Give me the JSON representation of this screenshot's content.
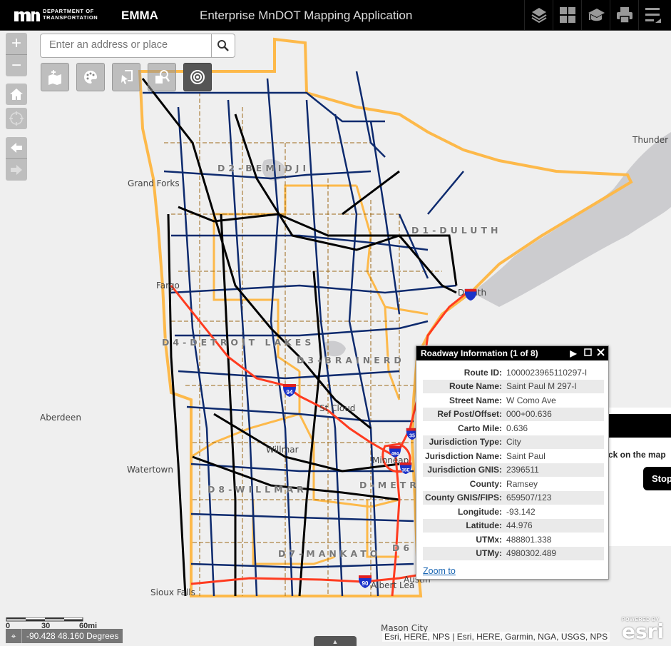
{
  "header": {
    "logo_text_line1": "DEPARTMENT OF",
    "logo_text_line2": "TRANSPORTATION",
    "app_name": "EMMA",
    "app_title": "Enterprise MnDOT Mapping Application",
    "buttons": [
      {
        "name": "layers",
        "icon": "layers-icon"
      },
      {
        "name": "basemap-gallery",
        "icon": "grid-icon"
      },
      {
        "name": "help",
        "icon": "graduation-cap-icon"
      },
      {
        "name": "print",
        "icon": "printer-icon"
      },
      {
        "name": "menu",
        "icon": "menu-icon"
      }
    ]
  },
  "map_controls": {
    "zoom_in": "+",
    "zoom_out": "−",
    "search_placeholder": "Enter an address or place",
    "search_value": "",
    "tools": [
      {
        "name": "add-data",
        "icon": "add-data-icon",
        "active": false
      },
      {
        "name": "symbology",
        "icon": "palette-icon",
        "active": false
      },
      {
        "name": "select",
        "icon": "select-icon",
        "active": false
      },
      {
        "name": "query",
        "icon": "query-icon",
        "active": false
      },
      {
        "name": "identify",
        "icon": "target-icon",
        "active": true
      }
    ]
  },
  "map_labels": {
    "places": [
      {
        "id": "grand-forks",
        "text": "Grand Forks"
      },
      {
        "id": "fargo",
        "text": "Fargo"
      },
      {
        "id": "duluth",
        "text": "Duluth"
      },
      {
        "id": "thunder-bay",
        "text": "Thunder B"
      },
      {
        "id": "aberdeen",
        "text": "Aberdeen"
      },
      {
        "id": "watertown",
        "text": "Watertown"
      },
      {
        "id": "st-cloud",
        "text": "St Cloud"
      },
      {
        "id": "willmar",
        "text": "Willmar"
      },
      {
        "id": "minneapolis",
        "text": "Minneap"
      },
      {
        "id": "sioux-falls",
        "text": "Sioux Falls"
      },
      {
        "id": "albert-lea",
        "text": "Albert Lea"
      },
      {
        "id": "austin",
        "text": "Austin"
      },
      {
        "id": "mason-city",
        "text": "Mason City"
      }
    ],
    "districts": [
      {
        "id": "d2",
        "text": "D2-BEMIDJI"
      },
      {
        "id": "d1",
        "text": "D1-DULUTH"
      },
      {
        "id": "d4",
        "text": "D4-DETROIT LAKES"
      },
      {
        "id": "d3",
        "text": "D3-BRAINERD"
      },
      {
        "id": "d8",
        "text": "D8-WILLMAR"
      },
      {
        "id": "metro",
        "text": "D-METRO"
      },
      {
        "id": "d7",
        "text": "D7-MANKATO"
      },
      {
        "id": "d6",
        "text": "D6"
      }
    ],
    "interstate_shields": [
      "94",
      "35",
      "494",
      "35E",
      "90"
    ]
  },
  "popup": {
    "title": "Roadway Information (1 of 8)",
    "fields": [
      {
        "label": "Route ID:",
        "value": "1000023965110297-I"
      },
      {
        "label": "Route Name:",
        "value": "Saint Paul M 297-I"
      },
      {
        "label": "Street Name:",
        "value": "W Como Ave"
      },
      {
        "label": "Ref Post/Offset:",
        "value": "000+00.636"
      },
      {
        "label": "Carto Mile:",
        "value": "0.636"
      },
      {
        "label": "Jurisdiction Type:",
        "value": "City"
      },
      {
        "label": "Jurisdiction Name:",
        "value": "Saint Paul"
      },
      {
        "label": "Jurisdiction GNIS:",
        "value": "2396511"
      },
      {
        "label": "County:",
        "value": "Ramsey"
      },
      {
        "label": "County GNIS/FIPS:",
        "value": "659507/123"
      },
      {
        "label": "Longitude:",
        "value": "-93.142"
      },
      {
        "label": "Latitude:",
        "value": "44.976"
      },
      {
        "label": "UTMx:",
        "value": "488801.338"
      },
      {
        "label": "UTMy:",
        "value": "4980302.489"
      }
    ],
    "zoom_to": "Zoom to"
  },
  "side_panel": {
    "message": "ck on the map",
    "stop_button": "Stop"
  },
  "scalebar": {
    "labels": [
      "0",
      "30",
      "60mi"
    ]
  },
  "coordinates": {
    "text": "-90.428 48.160 Degrees"
  },
  "attribution": "Esri, HERE, NPS | Esri, HERE, Garmin, NGA, USGS, NPS",
  "esri_logo": {
    "powered_by": "POWERED BY",
    "brand": "esri"
  },
  "colors": {
    "district_boundary": "#fdb94a",
    "county_boundary": "#9c6a1a",
    "state_highway": "#0d2a6e",
    "us_highway": "#000000",
    "interstate": "#ff3b1f",
    "water": "#cccccf",
    "map_background": "#efefef"
  }
}
